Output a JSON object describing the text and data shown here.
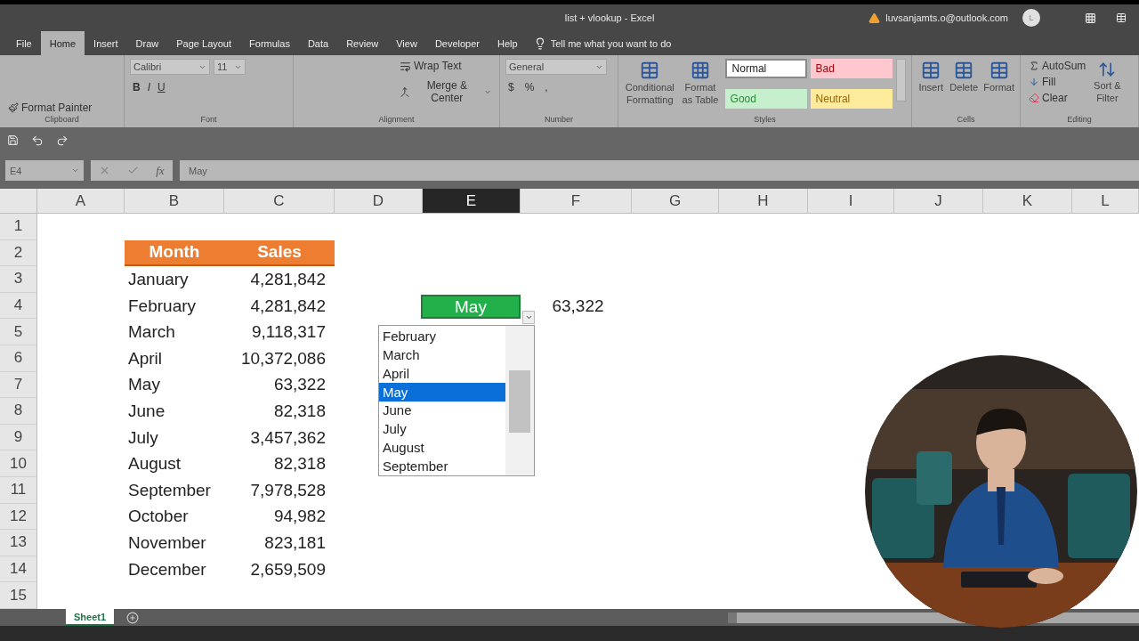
{
  "title_bar": {
    "title": "list + vlookup  -  Excel",
    "account": "luvsanjamts.o@outlook.com",
    "avatar": "L"
  },
  "menu_tabs": [
    {
      "label": "File",
      "selected": false
    },
    {
      "label": "Home",
      "selected": true
    },
    {
      "label": "Insert",
      "selected": false
    },
    {
      "label": "Draw",
      "selected": false
    },
    {
      "label": "Page Layout",
      "selected": false
    },
    {
      "label": "Formulas",
      "selected": false
    },
    {
      "label": "Data",
      "selected": false
    },
    {
      "label": "Review",
      "selected": false
    },
    {
      "label": "View",
      "selected": false
    },
    {
      "label": "Developer",
      "selected": false
    },
    {
      "label": "Help",
      "selected": false
    }
  ],
  "tell_me": "Tell me what you want to do",
  "ribbon": {
    "clipboard": {
      "format_painter": "Format Painter",
      "label": "Clipboard"
    },
    "font": {
      "font_name": "Calibri",
      "font_size": "11",
      "format_buttons": [
        "B",
        "I",
        "U"
      ],
      "label": "Font"
    },
    "alignment": {
      "wrap_text": "Wrap Text",
      "merge": "Merge & Center",
      "label": "Alignment"
    },
    "number": {
      "format": "General",
      "buttons": [
        "$",
        "%",
        ","
      ],
      "label": "Number"
    },
    "styles": {
      "conditional": "Conditional Formatting",
      "format_table": "Format as Table",
      "label": "Styles",
      "cell_styles": [
        {
          "name": "Normal",
          "kind": "normal",
          "color": "#ffffff"
        },
        {
          "name": "Bad",
          "kind": "bad",
          "color": "#ffc7ce"
        },
        {
          "name": "Good",
          "kind": "good",
          "color": "#c6efce"
        },
        {
          "name": "Neutral",
          "kind": "neutral",
          "color": "#ffeb9c"
        }
      ]
    },
    "cells": {
      "buttons": [
        "Insert",
        "Delete",
        "Format"
      ],
      "label": "Cells"
    },
    "editing": {
      "autosum": "AutoSum",
      "fill": "Fill",
      "clear": "Clear",
      "sort": "Sort & Filter",
      "label": "Editing"
    }
  },
  "formula_bar": {
    "name_box": "E4",
    "fx": "fx",
    "content": "May"
  },
  "columns": [
    {
      "label": "A",
      "selected": false
    },
    {
      "label": "B",
      "selected": false
    },
    {
      "label": "C",
      "selected": false
    },
    {
      "label": "D",
      "selected": false
    },
    {
      "label": "E",
      "selected": true
    },
    {
      "label": "F",
      "selected": false
    },
    {
      "label": "G",
      "selected": false
    },
    {
      "label": "H",
      "selected": false
    },
    {
      "label": "I",
      "selected": false
    },
    {
      "label": "J",
      "selected": false
    },
    {
      "label": "K",
      "selected": false
    },
    {
      "label": "L",
      "selected": false
    }
  ],
  "rows": [
    "1",
    "2",
    "3",
    "4",
    "5",
    "6",
    "7",
    "8",
    "9",
    "10",
    "11",
    "12",
    "13",
    "14",
    "15"
  ],
  "table": {
    "columns": [
      "Month",
      "Sales"
    ],
    "rows": [
      [
        "January",
        "4,281,842"
      ],
      [
        "February",
        "4,281,842"
      ],
      [
        "March",
        "9,118,317"
      ],
      [
        "April",
        "10,372,086"
      ],
      [
        "May",
        "63,322"
      ],
      [
        "June",
        "82,318"
      ],
      [
        "July",
        "3,457,362"
      ],
      [
        "August",
        "82,318"
      ],
      [
        "September",
        "7,978,528"
      ],
      [
        "October",
        "94,982"
      ],
      [
        "November",
        "823,181"
      ],
      [
        "December",
        "2,659,509"
      ]
    ]
  },
  "lookup": {
    "value": "May",
    "result": "63,322"
  },
  "dropdown": {
    "items": [
      {
        "label": "February",
        "selected": false
      },
      {
        "label": "March",
        "selected": false
      },
      {
        "label": "April",
        "selected": false
      },
      {
        "label": "May",
        "selected": true
      },
      {
        "label": "June",
        "selected": false
      },
      {
        "label": "July",
        "selected": false
      },
      {
        "label": "August",
        "selected": false
      },
      {
        "label": "September",
        "selected": false
      }
    ]
  },
  "sheet_tabs": [
    {
      "label": "Sheet1",
      "selected": true
    }
  ]
}
